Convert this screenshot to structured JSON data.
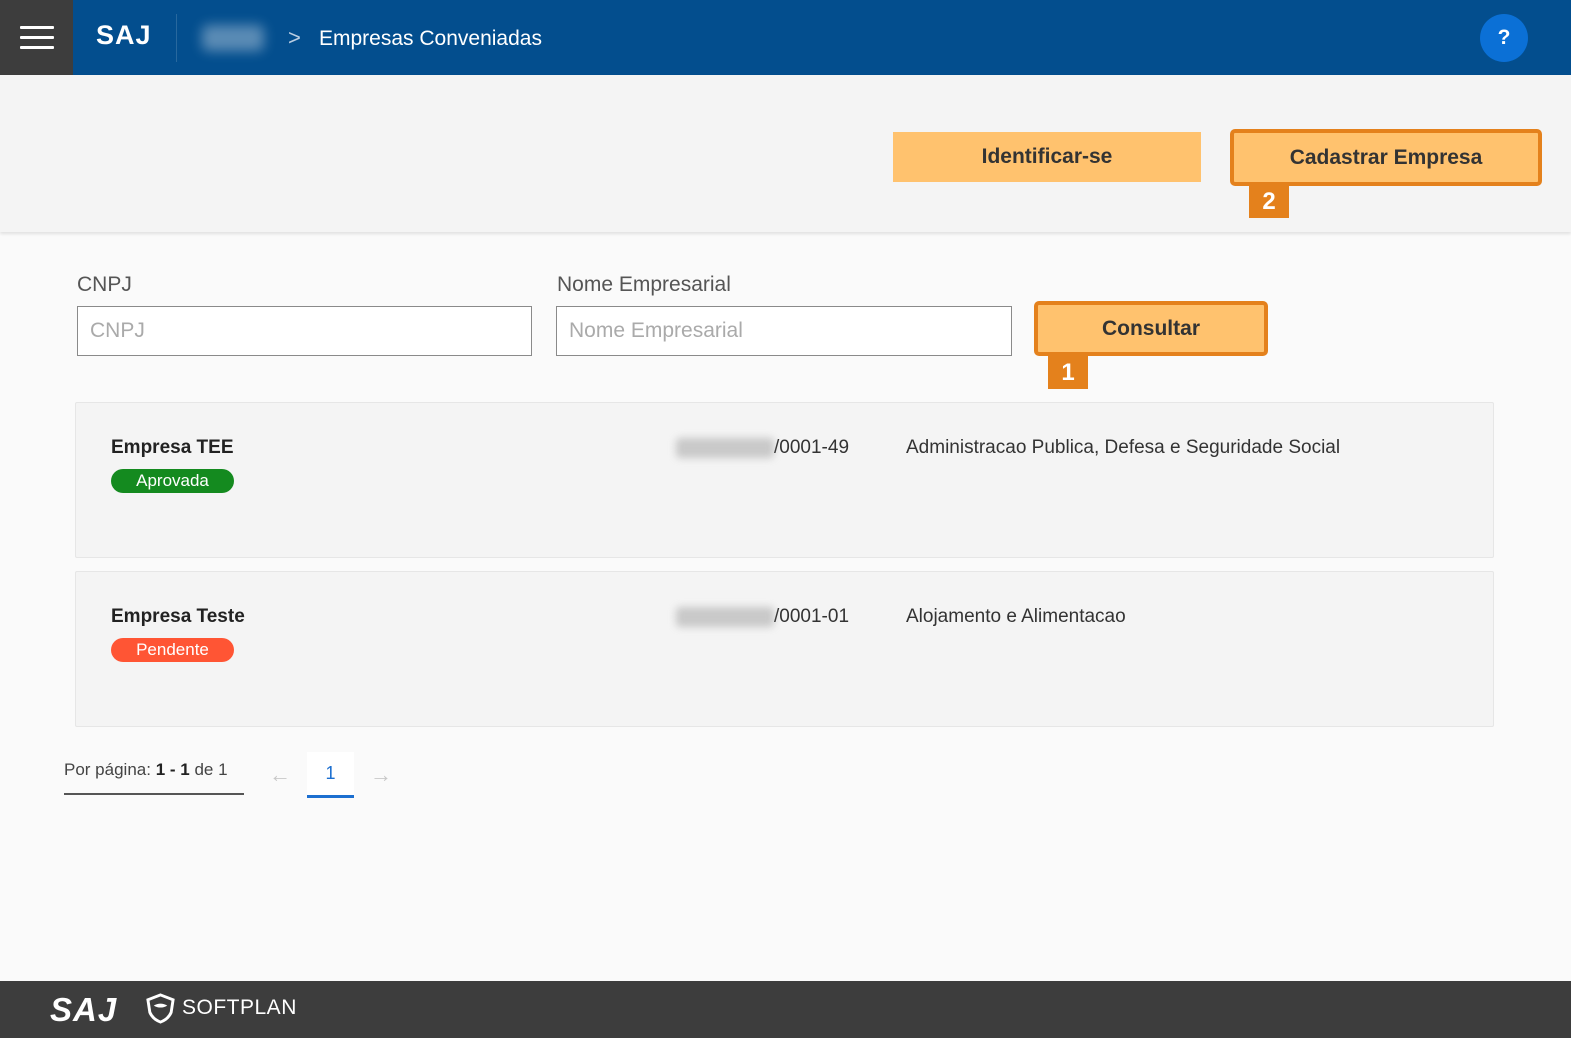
{
  "header": {
    "brand": "SAJ",
    "page_title": "Empresas Conveniadas",
    "breadcrumb_separator": ">",
    "help_label": "?"
  },
  "actions": {
    "identify_label": "Identificar-se",
    "register_label": "Cadastrar Empresa",
    "register_step": "2"
  },
  "filters": {
    "cnpj_label": "CNPJ",
    "cnpj_placeholder": "CNPJ",
    "cnpj_value": "",
    "name_label": "Nome Empresarial",
    "name_placeholder": "Nome Empresarial",
    "name_value": "",
    "search_label": "Consultar",
    "search_step": "1"
  },
  "results": [
    {
      "name": "Empresa TEE",
      "status": "Aprovada",
      "cnpj_suffix": "/0001-49",
      "activity": "Administracao Publica, Defesa e Seguridade Social"
    },
    {
      "name": "Empresa Teste",
      "status": "Pendente",
      "cnpj_suffix": "/0001-01",
      "activity": "Alojamento e Alimentacao"
    }
  ],
  "pagination": {
    "per_page_label": "Por página:",
    "range": "1 - 1",
    "of_label": "de",
    "total": "1",
    "current_page": "1"
  },
  "footer": {
    "brand": "SAJ",
    "company": "SOFTPLAN"
  },
  "colors": {
    "topbar": "#034e8e",
    "accent_orange": "#e4811c",
    "button_orange": "#ffc26e",
    "status_approved": "#148a1f",
    "status_pending": "#ff5534"
  }
}
